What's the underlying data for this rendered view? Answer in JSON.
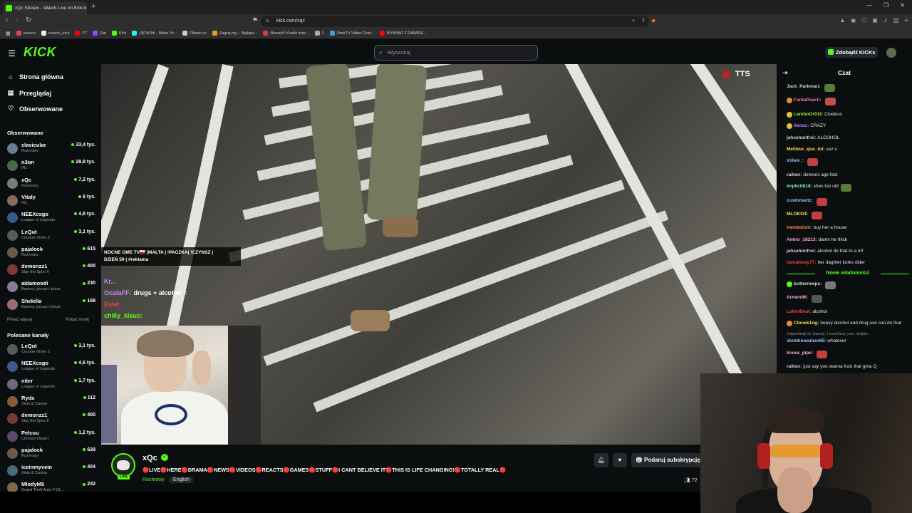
{
  "browser": {
    "tab_title": "xQc Stream - Watch Live on Kick",
    "url": "kick.com/xqc",
    "bookmarks": [
      {
        "label": "nowciu",
        "color": "#e4405f"
      },
      {
        "label": "nowciu_kick",
        "color": "#eeeeee"
      },
      {
        "label": "YT",
        "color": "#ff0000"
      },
      {
        "label": "Rat",
        "color": "#9146ff"
      },
      {
        "label": "Kick",
        "color": "#53fc18"
      },
      {
        "label": "(4)TikTok - Make Yo...",
        "color": "#25f4ee"
      },
      {
        "label": "Filman.cc",
        "color": "#cccccc"
      },
      {
        "label": "Zagraj.my – Najleps...",
        "color": "#e0a020"
      },
      {
        "label": "Nowość! Kostki mas...",
        "color": "#d04040"
      },
      {
        "label": "1",
        "color": "#aaaaaa"
      },
      {
        "label": "OmeTV Video Chat...",
        "color": "#3aa0e0"
      },
      {
        "label": "WYWIAD Z DAWIDE...",
        "color": "#ff0000"
      }
    ]
  },
  "header": {
    "logo": "KICK",
    "search_placeholder": "Wyszukaj",
    "get_kicks": "Zdobądź KICKs"
  },
  "sidebar": {
    "nav": [
      {
        "label": "Strona główna",
        "icon": "home-icon"
      },
      {
        "label": "Przeglądaj",
        "icon": "browse-icon"
      },
      {
        "label": "Obserwowane",
        "icon": "heart-icon"
      }
    ],
    "followed_title": "Obserwowane",
    "followed": [
      {
        "name": "clavicular",
        "category": "Rozmowy",
        "viewers": "33,4 tys.",
        "color": "#6a7b8c"
      },
      {
        "name": "n3on",
        "category": "IRL",
        "viewers": "29,8 tys.",
        "color": "#4a6a4a"
      },
      {
        "name": "xQc",
        "category": "Rozmowy",
        "viewers": "7,2 tys.",
        "color": "#7a7a7a"
      },
      {
        "name": "Vitaly",
        "category": "IRL",
        "viewers": "6 tys.",
        "color": "#8a6a5a"
      },
      {
        "name": "NEEXcsgo",
        "category": "League of Legends",
        "viewers": "4,6 tys.",
        "color": "#3a5a8a"
      },
      {
        "name": "LeQut",
        "category": "Counter-Strike 2",
        "viewers": "3,1 tys.",
        "color": "#5a5a5a"
      },
      {
        "name": "pajalock",
        "category": "Rozmowy",
        "viewers": "615",
        "color": "#6a5a4a"
      },
      {
        "name": "demonzz1",
        "category": "Slay the Spire II",
        "viewers": "400",
        "color": "#7a3a3a"
      },
      {
        "name": "aidamoodi",
        "category": "Baseny, jacuzzi i plaże",
        "viewers": "230",
        "color": "#8a7a9a"
      },
      {
        "name": "Shekilla",
        "category": "Baseny, jacuzzi i plaże",
        "viewers": "168",
        "color": "#9a6a7a"
      }
    ],
    "show_more": "Pokaż więcej",
    "show_less": "Pokaż mniej",
    "recommended_title": "Polecane kanały",
    "recommended": [
      {
        "name": "LeQut",
        "category": "Counter-Strike 2",
        "viewers": "3,1 tys.",
        "color": "#5a5a5a"
      },
      {
        "name": "NEEXcsgo",
        "category": "League of Legends",
        "viewers": "4,6 tys.",
        "color": "#3a5a8a"
      },
      {
        "name": "niter",
        "category": "League of Legends",
        "viewers": "1,7 tys.",
        "color": "#6a6a7a"
      },
      {
        "name": "Ryda",
        "category": "Slots & Casino",
        "viewers": "112",
        "color": "#8a5a3a"
      },
      {
        "name": "demonzz1",
        "category": "Slay the Spire II",
        "viewers": "400",
        "color": "#7a3a3a"
      },
      {
        "name": "Pelcuu",
        "category": "Crimson Desert",
        "viewers": "1,2 tys.",
        "color": "#5a4a6a"
      },
      {
        "name": "pajalock",
        "category": "Rozmowy",
        "viewers": "629",
        "color": "#6a5a4a"
      },
      {
        "name": "iceinmyvein",
        "category": "Slots & Casino",
        "viewers": "404",
        "color": "#4a6a7a"
      },
      {
        "name": "MlodyM5",
        "category": "Grand Theft Auto V (G...",
        "viewers": "242",
        "color": "#7a6a4a"
      }
    ]
  },
  "video": {
    "tts_label": "TTS",
    "banner_line1": "NOCNE OME TV🇵🇱 |MALTA | !PACZKA| !CZYNSZ |",
    "banner_line2": "DZIEŃ 59 | #reklama",
    "overlay_messages": [
      {
        "user": "Kr...",
        "text": "",
        "color": "#c084fc"
      },
      {
        "user": "OcalaFF:",
        "text": "drugs + alcohol =",
        "color": "#c084fc"
      },
      {
        "user": "Eslet:",
        "text": "",
        "color": "#ef4444"
      },
      {
        "user": "chilly_klaus:",
        "text": "",
        "color": "#53fc18"
      }
    ]
  },
  "stream": {
    "name": "xQc",
    "live_badge": "LIVE",
    "title": "🔴LIVE🔴HERE🔴DRAMA🔴NEWS🔴VIDEOS🔴REACTS🔴GAMES🔴STUFF🔴I CANT BELIEVE IT🔴THIS IS LIFE CHANGING!🔴TOTALLY REAL🔴",
    "category": "Rozmowy",
    "language": "English",
    "gift_button": "Podaruj subskrypcję",
    "viewers": "72"
  },
  "chat": {
    "title": "Czat",
    "new_messages": "Nowe wiadomości",
    "messages_before": [
      {
        "user": "Jack_Parkman:",
        "text": "",
        "color": "#d1d5db",
        "emote": "#5a7a3a"
      },
      {
        "user": "FantaPeach:",
        "text": "",
        "color": "#f472b6",
        "emote": "#c05050",
        "badge": "#e08a3a"
      },
      {
        "user": "LamboOrDi3:",
        "text": "Clueless",
        "color": "#a3e635",
        "badge": "#e0c040"
      },
      {
        "user": "Xenax:",
        "text": "CRAZY",
        "color": "#c084fc",
        "badge": "#e0c040"
      },
      {
        "user": "jahsehonfroi:",
        "text": "ALCOHOL",
        "color": "#d1d5db"
      },
      {
        "user": "Meilleur_que_toi:",
        "text": "sez u",
        "color": "#fde047"
      },
      {
        "user": "xView_:",
        "text": "",
        "color": "#93c5fd",
        "emote": "#c04040"
      },
      {
        "user": "raikxn:",
        "text": "demons age fast",
        "color": "#d1d5db"
      },
      {
        "user": "implicit818:",
        "text": "shes too old",
        "color": "#86efac",
        "emote": "#5a7a3a"
      },
      {
        "user": "customartz:",
        "text": "",
        "color": "#93c5fd",
        "emote": "#c04040"
      },
      {
        "user": "MLOKO4:",
        "text": "",
        "color": "#fde047",
        "emote": "#c04040"
      },
      {
        "user": "tremboloni:",
        "text": "buy her a house",
        "color": "#fb923c"
      },
      {
        "user": "Antno_18213:",
        "text": "damn he thick",
        "color": "#f9a8d4"
      },
      {
        "user": "jahsehonfroi:",
        "text": "alcohol do that to a mf",
        "color": "#d1d5db"
      },
      {
        "user": "zamaleszy77:",
        "text": "her daghter looks older",
        "color": "#ef4444"
      }
    ],
    "messages_after": [
      {
        "user": "butterneeps:",
        "text": "",
        "color": "#d1d5db",
        "emote": "#777777",
        "badge": "#53fc18"
      },
      {
        "user": "Armen96:",
        "text": "",
        "color": "#f9a8d4",
        "emote": "#555555"
      },
      {
        "user": "LatterBeat:",
        "text": "alcohol",
        "color": "#ef4444"
      },
      {
        "user": "Clonek1ng:",
        "text": "heavy alcohol and drug use can do that",
        "color": "#fde047",
        "badge": "#e08a3a"
      },
      {
        "reply": "Odpowiedź do Sacety: I could buy your neighb..."
      },
      {
        "user": "idontknowman65:",
        "text": "whatever",
        "color": "#93c5fd"
      },
      {
        "user": "kiowa_pipe:",
        "text": "",
        "color": "#f9a8d4",
        "emote": "#c04040"
      },
      {
        "user": "raikxn:",
        "text": "just say you wanna fuck that gma Q",
        "color": "#d1d5db"
      }
    ]
  }
}
